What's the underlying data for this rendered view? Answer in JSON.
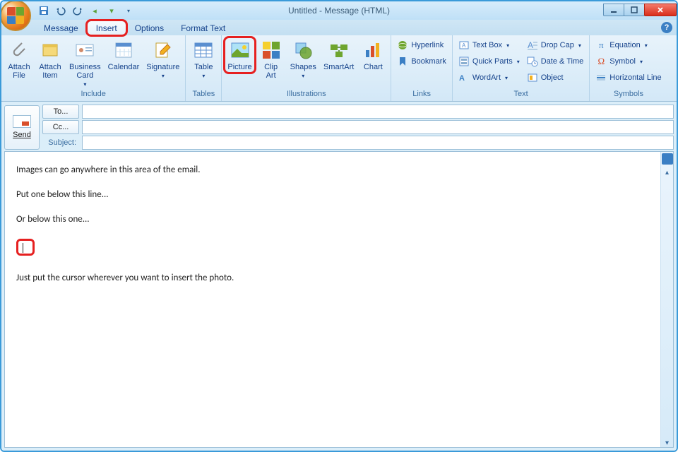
{
  "titlebar": {
    "title": "Untitled - Message (HTML)"
  },
  "qat": {
    "save": "Save",
    "undo": "Undo",
    "redo": "Redo",
    "prev": "Previous",
    "next": "Next"
  },
  "tabs": {
    "message": "Message",
    "insert": "Insert",
    "options": "Options",
    "format_text": "Format Text"
  },
  "ribbon": {
    "include": {
      "label": "Include",
      "attach_file": "Attach\nFile",
      "attach_item": "Attach\nItem",
      "business_card": "Business\nCard",
      "calendar": "Calendar",
      "signature": "Signature"
    },
    "tables": {
      "label": "Tables",
      "table": "Table"
    },
    "illustrations": {
      "label": "Illustrations",
      "picture": "Picture",
      "clip_art": "Clip\nArt",
      "shapes": "Shapes",
      "smartart": "SmartArt",
      "chart": "Chart"
    },
    "links": {
      "label": "Links",
      "hyperlink": "Hyperlink",
      "bookmark": "Bookmark"
    },
    "text": {
      "label": "Text",
      "text_box": "Text Box",
      "quick_parts": "Quick Parts",
      "wordart": "WordArt",
      "drop_cap": "Drop Cap",
      "date_time": "Date & Time",
      "object": "Object"
    },
    "symbols": {
      "label": "Symbols",
      "equation": "Equation",
      "symbol": "Symbol",
      "horizontal_line": "Horizontal Line"
    }
  },
  "compose": {
    "send": "Send",
    "to": "To...",
    "cc": "Cc...",
    "subject_label": "Subject:",
    "to_value": "",
    "cc_value": "",
    "subject_value": ""
  },
  "body": {
    "p1": "Images can go anywhere in this area of the email.",
    "p2": "Put one below this line...",
    "p3": "Or below this one...",
    "p4": "Just put the cursor wherever you want to insert the photo."
  }
}
